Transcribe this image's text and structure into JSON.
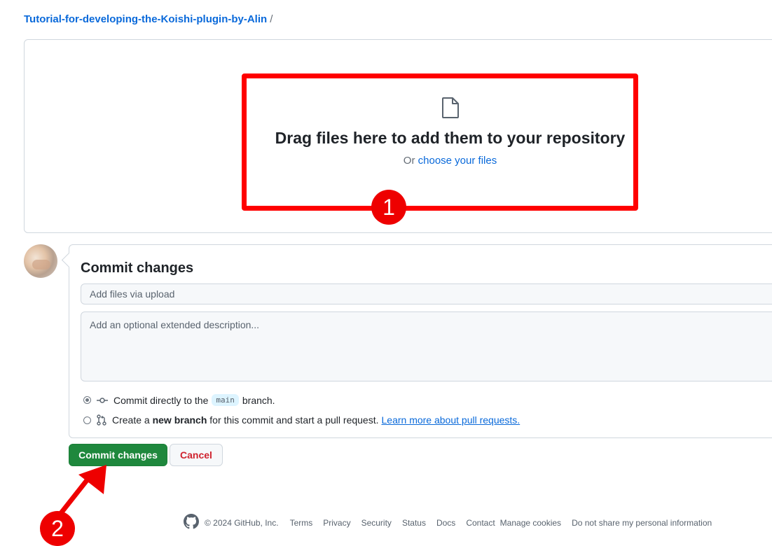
{
  "breadcrumb": {
    "repo": "Tutorial-for-developing-the-Koishi-plugin-by-Alin",
    "separator": "/"
  },
  "dropzone": {
    "title": "Drag files here to add them to your repository",
    "prefix": "Or",
    "link": "choose your files"
  },
  "commit": {
    "title": "Commit changes",
    "message_placeholder": "Add files via upload",
    "description_placeholder": "Add an optional extended description...",
    "option_direct": {
      "before": "Commit directly to the",
      "branch": "main",
      "after": "branch."
    },
    "option_new": {
      "before": "Create a",
      "bold": "new branch",
      "after": "for this commit and start a pull request.",
      "link": "Learn more about pull requests."
    },
    "selected_option": "direct"
  },
  "buttons": {
    "commit": "Commit changes",
    "cancel": "Cancel"
  },
  "footer": {
    "copyright": "© 2024 GitHub, Inc.",
    "links": [
      "Terms",
      "Privacy",
      "Security",
      "Status",
      "Docs",
      "Contact",
      "Manage cookies",
      "Do not share my personal information"
    ]
  },
  "annotations": {
    "step1": "1",
    "step2": "2",
    "color": "#ff0000"
  },
  "icons": {
    "file": "file-icon",
    "commit": "git-commit-icon",
    "pull_request": "git-pull-request-icon",
    "github": "github-mark-icon"
  }
}
